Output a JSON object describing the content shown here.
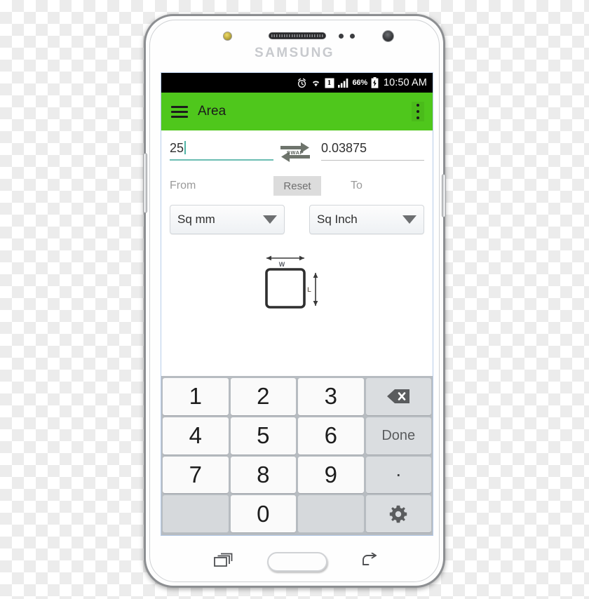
{
  "device": {
    "brand": "SAMSUNG",
    "hardware": {
      "earpiece": "earpiece-speaker",
      "front_camera": "front-camera",
      "sensor_led": "notification-led",
      "proximity_sensors": "proximity-sensor"
    },
    "nav": {
      "recent_label": "Recent apps",
      "home_label": "Home",
      "back_label": "Back"
    }
  },
  "status_bar": {
    "icons": [
      "alarm-icon",
      "wifi-icon",
      "sim-1-icon",
      "signal-bars-icon",
      "battery-charging-icon"
    ],
    "sim_slot": "1",
    "battery_percent": "66%",
    "clock": "10:50 AM"
  },
  "app_bar": {
    "menu_icon": "hamburger-menu-icon",
    "title": "Area",
    "overflow_icon": "overflow-menu-icon",
    "accent_color": "#4fc71c"
  },
  "converter": {
    "from": {
      "value": "25",
      "label": "From",
      "unit": "Sq mm",
      "underline_color": "#6bbdb2",
      "caret_color": "#4fb3a5"
    },
    "to": {
      "value": "0.03875",
      "label": "To",
      "unit": "Sq Inch",
      "underline_color": "#bdbdbd"
    },
    "swap": {
      "label": "SWAP",
      "icon": "swap-arrows-icon"
    },
    "reset": {
      "label": "Reset"
    },
    "dropdown_icon": "chevron-down-icon"
  },
  "illustration": {
    "name": "rectangle-area-diagram",
    "width_label": "W",
    "length_label": "L"
  },
  "keypad": {
    "rows": [
      [
        {
          "label": "1",
          "type": "num",
          "name": "key-1"
        },
        {
          "label": "2",
          "type": "num",
          "name": "key-2"
        },
        {
          "label": "3",
          "type": "num",
          "name": "key-3"
        },
        {
          "label": "",
          "type": "backspace",
          "name": "key-backspace"
        }
      ],
      [
        {
          "label": "4",
          "type": "num",
          "name": "key-4"
        },
        {
          "label": "5",
          "type": "num",
          "name": "key-5"
        },
        {
          "label": "6",
          "type": "num",
          "name": "key-6"
        },
        {
          "label": "Done",
          "type": "fn",
          "name": "key-done"
        }
      ],
      [
        {
          "label": "7",
          "type": "num",
          "name": "key-7"
        },
        {
          "label": "8",
          "type": "num",
          "name": "key-8"
        },
        {
          "label": "9",
          "type": "num",
          "name": "key-9"
        },
        {
          "label": ".",
          "type": "dot",
          "name": "key-decimal"
        }
      ],
      [
        {
          "label": "",
          "type": "blank",
          "name": "key-blank-left"
        },
        {
          "label": "0",
          "type": "num",
          "name": "key-0"
        },
        {
          "label": "",
          "type": "blank",
          "name": "key-blank-right"
        },
        {
          "label": "",
          "type": "settings",
          "name": "key-settings"
        }
      ]
    ]
  }
}
